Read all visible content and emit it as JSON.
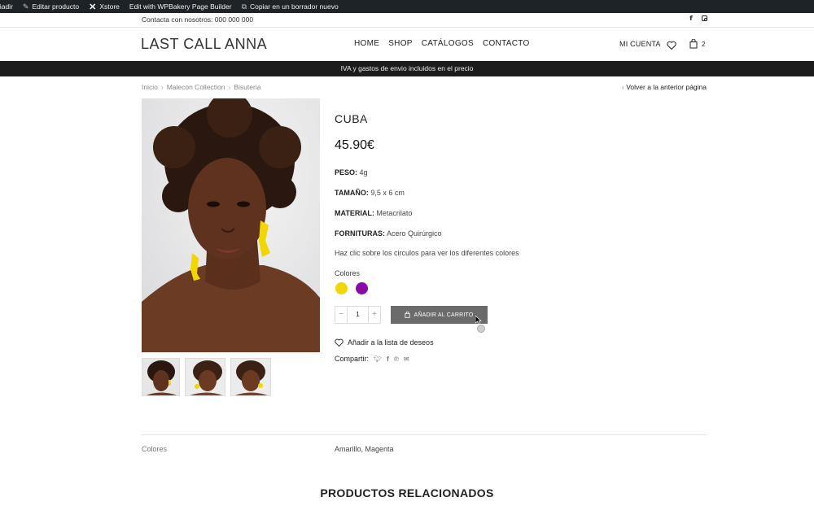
{
  "admin_bar": {
    "items": [
      {
        "label": "ñadir",
        "icon": "plus-icon"
      },
      {
        "label": "Editar producto",
        "icon": "pencil-icon"
      },
      {
        "label": "Xstore",
        "icon": "xstore-icon"
      },
      {
        "label": "Edit with WPBakery Page Builder",
        "icon": ""
      },
      {
        "label": "Copiar en un borrador nuevo",
        "icon": "copy-icon"
      }
    ]
  },
  "topbar": {
    "contact": "Contacta con nosotros: 000 000 000",
    "social": [
      "facebook-icon",
      "instagram-icon"
    ]
  },
  "header": {
    "logo": "LAST CALL ANNA",
    "nav": [
      "HOME",
      "SHOP",
      "CATÁLOGOS",
      "CONTACTO"
    ],
    "account": "MI CUENTA",
    "cart_count": "2"
  },
  "promo": "IVA y gastos de envio incluidos en el precio",
  "breadcrumb": [
    "Inicio",
    "Malecon Collection",
    "Bisuteria"
  ],
  "back_link": "Volver a la anterior página",
  "product": {
    "title": "CUBA",
    "price": "45.90€",
    "attributes": [
      {
        "label": "PESO:",
        "value": "4g"
      },
      {
        "label": "TAMAÑO:",
        "value": "9,5 x 6 cm"
      },
      {
        "label": "MATERIAL:",
        "value": "Metacrilato"
      },
      {
        "label": "FORNITURAS:",
        "value": "Acero Quirúrgico"
      }
    ],
    "note": "Haz clic sobre los circulos para ver los diferentes colores",
    "colors_label": "Colores",
    "swatches": [
      {
        "name": "Amarillo",
        "color": "#f2d600"
      },
      {
        "name": "Magenta",
        "color": "#8a0aa6"
      }
    ],
    "quantity": "1",
    "add_to_cart": "AÑADIR AL CARRITO",
    "wishlist": "Añadir a la lista de deseos",
    "share_label": "Compartir:"
  },
  "additional_info": {
    "key": "Colores",
    "value": "Amarillo, Magenta"
  },
  "related_title": "PRODUCTOS RELACIONADOS",
  "colors": {
    "accent_dark": "#1c1c1c",
    "button": "#6b6b6b"
  }
}
